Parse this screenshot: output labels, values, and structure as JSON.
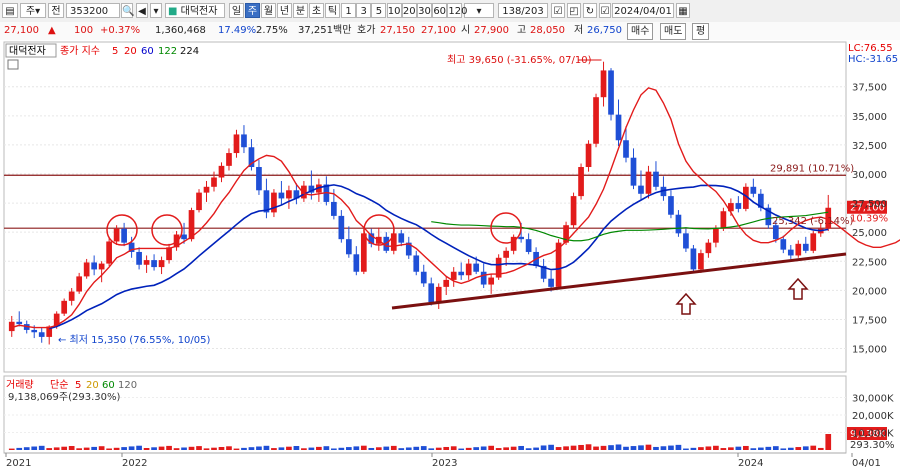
{
  "toolbar": {
    "market_label": "주",
    "period_label": "전",
    "stock_code": "353200",
    "stock_name": "대덕전자",
    "period_tabs": [
      "일",
      "주",
      "월",
      "년",
      "분",
      "초",
      "틱"
    ],
    "active_period": "주",
    "interval_buttons": [
      "1",
      "3",
      "5",
      "10",
      "20",
      "30",
      "60",
      "120"
    ],
    "page_counter": "138/203",
    "date_value": "2024/04/01"
  },
  "quote": {
    "price": "27,100",
    "change_arrow": "▲",
    "change": "100",
    "change_pct": "+0.37%",
    "volume": "1,360,468",
    "pct1": "17.49%",
    "pct2": "2.75%",
    "trade_value": "37,251백만",
    "ask_label": "호가",
    "ask_price": "27,150",
    "bid_price": "27,100",
    "open_label": "시",
    "open": "27,900",
    "high_label": "고",
    "high": "28,050",
    "low_label": "저",
    "low": "26,750",
    "buy_label": "매수",
    "sell_label": "매도",
    "eval_label": "평"
  },
  "price_panel": {
    "legend_name": "대덕전자",
    "legend_title": "종가 지수",
    "ma_periods": [
      "5",
      "20",
      "60",
      "122",
      "224"
    ],
    "ma_colors": [
      "#e60000",
      "#0000cc",
      "#008800",
      "#5599ff",
      "#111111"
    ],
    "lc_label": "LC:76.55",
    "hc_label": "HC:-31.65",
    "high_annotation": "최고 39,650 (-31.65%, 07/10)",
    "low_annotation": "최저 15,350 (76.55%, 10/05)",
    "resistance_label": "29,891 (10.71%)",
    "support_label": "25,342 (-6.14%)",
    "current_tag": "27,100",
    "current_pct": "10.39%"
  },
  "volume_panel": {
    "legend_title": "거래량",
    "legend_ma_label": "단순",
    "ma_periods": [
      "5",
      "20",
      "60",
      "120"
    ],
    "volume_readout": "9,138,069주(293.30%)",
    "axis_ticks": [
      "30,000K",
      "20,000K",
      "10,000K"
    ],
    "current_tag": "9,138K",
    "current_pct": "293.30%"
  },
  "x_labels": [
    "2021",
    "2022",
    "2023",
    "2024",
    "04/01"
  ],
  "chart_data": {
    "type": "candlestick",
    "title": "대덕전자 (353200) 주봉",
    "ylim": [
      13500,
      41000
    ],
    "y_ticks": [
      15000,
      17500,
      20000,
      22500,
      25000,
      27500,
      30000,
      32500,
      35000,
      37500
    ],
    "horizontal_lines": [
      29891,
      25342
    ],
    "candles": [
      [
        16500,
        17800,
        16000,
        17300
      ],
      [
        17300,
        18200,
        16900,
        17100
      ],
      [
        17100,
        17400,
        16300,
        16600
      ],
      [
        16600,
        17000,
        15900,
        16400
      ],
      [
        16400,
        16800,
        15500,
        16000
      ],
      [
        16000,
        17000,
        15350,
        16900
      ],
      [
        16900,
        18200,
        16700,
        18000
      ],
      [
        18000,
        19300,
        17800,
        19100
      ],
      [
        19100,
        20200,
        18700,
        19900
      ],
      [
        19900,
        21500,
        19700,
        21200
      ],
      [
        21200,
        22700,
        21000,
        22400
      ],
      [
        22400,
        23000,
        21300,
        21800
      ],
      [
        21800,
        22500,
        20700,
        22300
      ],
      [
        22300,
        24500,
        22100,
        24200
      ],
      [
        24200,
        25600,
        23900,
        25300
      ],
      [
        25300,
        25800,
        23800,
        24100
      ],
      [
        24100,
        24600,
        22800,
        23300
      ],
      [
        23300,
        23700,
        21800,
        22200
      ],
      [
        22200,
        23000,
        21500,
        22600
      ],
      [
        22600,
        23100,
        21700,
        22000
      ],
      [
        22000,
        22900,
        21400,
        22600
      ],
      [
        22600,
        24000,
        22300,
        23700
      ],
      [
        23700,
        25100,
        23400,
        24800
      ],
      [
        24800,
        25800,
        24000,
        24400
      ],
      [
        24400,
        27100,
        24200,
        26900
      ],
      [
        26900,
        28700,
        26700,
        28400
      ],
      [
        28400,
        29400,
        27600,
        28900
      ],
      [
        28900,
        30200,
        28500,
        29700
      ],
      [
        29700,
        31000,
        29300,
        30700
      ],
      [
        30700,
        32200,
        30300,
        31800
      ],
      [
        31800,
        33800,
        31400,
        33400
      ],
      [
        33400,
        34200,
        31800,
        32300
      ],
      [
        32300,
        33000,
        30300,
        30600
      ],
      [
        30600,
        31200,
        28200,
        28600
      ],
      [
        28600,
        29600,
        26200,
        26700
      ],
      [
        26700,
        28700,
        26300,
        28400
      ],
      [
        28400,
        29400,
        27300,
        27900
      ],
      [
        27900,
        29000,
        27000,
        28600
      ],
      [
        28600,
        29200,
        27400,
        27900
      ],
      [
        27900,
        29400,
        27600,
        29000
      ],
      [
        29000,
        30300,
        27800,
        28400
      ],
      [
        28400,
        29600,
        27600,
        29100
      ],
      [
        29100,
        29800,
        27300,
        27600
      ],
      [
        27600,
        28700,
        26100,
        26400
      ],
      [
        26400,
        26900,
        24100,
        24400
      ],
      [
        24400,
        25500,
        22800,
        23100
      ],
      [
        23100,
        23800,
        21300,
        21600
      ],
      [
        21600,
        25200,
        21400,
        24900
      ],
      [
        24900,
        25300,
        23700,
        24000
      ],
      [
        24000,
        25400,
        23400,
        24600
      ],
      [
        24600,
        25000,
        23200,
        23400
      ],
      [
        23400,
        25300,
        23100,
        24900
      ],
      [
        24900,
        25200,
        23800,
        24100
      ],
      [
        24100,
        24600,
        22700,
        23000
      ],
      [
        23000,
        23400,
        21300,
        21600
      ],
      [
        21600,
        22200,
        20300,
        20600
      ],
      [
        20600,
        21100,
        18700,
        19000
      ],
      [
        19000,
        20600,
        18400,
        20300
      ],
      [
        20300,
        21200,
        19600,
        20900
      ],
      [
        20900,
        22000,
        20300,
        21600
      ],
      [
        21600,
        22400,
        20900,
        21300
      ],
      [
        21300,
        22700,
        20900,
        22300
      ],
      [
        22300,
        22900,
        21400,
        21600
      ],
      [
        21600,
        22300,
        20200,
        20500
      ],
      [
        20500,
        21400,
        19700,
        21100
      ],
      [
        21100,
        23100,
        20900,
        22800
      ],
      [
        22800,
        23700,
        22100,
        23400
      ],
      [
        23400,
        24800,
        23100,
        24600
      ],
      [
        24600,
        25800,
        24100,
        24400
      ],
      [
        24400,
        24900,
        23100,
        23300
      ],
      [
        23300,
        23700,
        21900,
        22100
      ],
      [
        22100,
        22700,
        20700,
        21000
      ],
      [
        21000,
        21700,
        19900,
        20300
      ],
      [
        20300,
        24400,
        20100,
        24100
      ],
      [
        24100,
        25900,
        23900,
        25600
      ],
      [
        25600,
        28400,
        25300,
        28100
      ],
      [
        28100,
        30900,
        27800,
        30600
      ],
      [
        30600,
        32900,
        30200,
        32600
      ],
      [
        32600,
        36900,
        32300,
        36600
      ],
      [
        36600,
        39650,
        35800,
        38900
      ],
      [
        38900,
        39100,
        34600,
        35100
      ],
      [
        35100,
        36400,
        32400,
        32900
      ],
      [
        32900,
        34100,
        31000,
        31400
      ],
      [
        31400,
        32200,
        28700,
        29000
      ],
      [
        29000,
        30300,
        27800,
        28300
      ],
      [
        28300,
        30700,
        27900,
        30200
      ],
      [
        30200,
        31100,
        28600,
        28900
      ],
      [
        28900,
        29800,
        27700,
        28100
      ],
      [
        28100,
        28600,
        26200,
        26500
      ],
      [
        26500,
        26900,
        24600,
        24900
      ],
      [
        24900,
        25300,
        23300,
        23600
      ],
      [
        23600,
        23900,
        21500,
        21800
      ],
      [
        21800,
        23500,
        21500,
        23200
      ],
      [
        23200,
        24400,
        22800,
        24100
      ],
      [
        24100,
        25600,
        23700,
        25300
      ],
      [
        25300,
        27100,
        25100,
        26800
      ],
      [
        26800,
        27900,
        26400,
        27500
      ],
      [
        27500,
        28100,
        26700,
        27000
      ],
      [
        27000,
        29200,
        26800,
        28900
      ],
      [
        28900,
        29600,
        28000,
        28300
      ],
      [
        28300,
        28700,
        26800,
        27100
      ],
      [
        27100,
        27400,
        25300,
        25600
      ],
      [
        25600,
        26000,
        24100,
        24400
      ],
      [
        24400,
        24700,
        23200,
        23500
      ],
      [
        23500,
        23900,
        22700,
        23000
      ],
      [
        23000,
        24300,
        22800,
        24000
      ],
      [
        24000,
        24600,
        23200,
        23400
      ],
      [
        23400,
        25100,
        23200,
        24900
      ],
      [
        24900,
        25800,
        24600,
        25300
      ],
      [
        25300,
        28200,
        25100,
        27100
      ]
    ],
    "ma5": [
      16800,
      17000,
      16900,
      16800,
      16800,
      16800,
      17000,
      17400,
      17900,
      18800,
      19900,
      20700,
      21300,
      22000,
      22800,
      23100,
      23500,
      23600,
      23600,
      23600,
      23600,
      23600,
      23800,
      24200,
      24600,
      25100,
      25800,
      26600,
      27600,
      28400,
      29400,
      30300,
      30900,
      31300,
      31600,
      31500,
      31100,
      30200,
      29100,
      28300,
      28200,
      28300,
      28400,
      28300,
      27800,
      27100,
      26000,
      25400,
      24700,
      24300,
      23800,
      23800,
      23900,
      24000,
      23600,
      23000,
      22400,
      21800,
      21200,
      20800,
      20600,
      20800,
      21100,
      21300,
      21400,
      21400,
      21500,
      21700,
      22000,
      22300,
      22700,
      23000,
      23200,
      23600,
      24200,
      24900,
      25600,
      26300,
      27400,
      28700,
      30400,
      32200,
      34000,
      35500,
      36800,
      37400,
      37200,
      36100,
      34700,
      32600,
      31100,
      30200,
      29600,
      29000,
      28500,
      27700,
      26700,
      25600,
      24800,
      24300,
      24100,
      24100,
      24300,
      24600,
      25200,
      25700,
      26000,
      26200,
      26300,
      26100,
      25700,
      25200,
      24700,
      24200,
      23900,
      23700,
      23700,
      23900,
      24100,
      24500
    ]
  }
}
